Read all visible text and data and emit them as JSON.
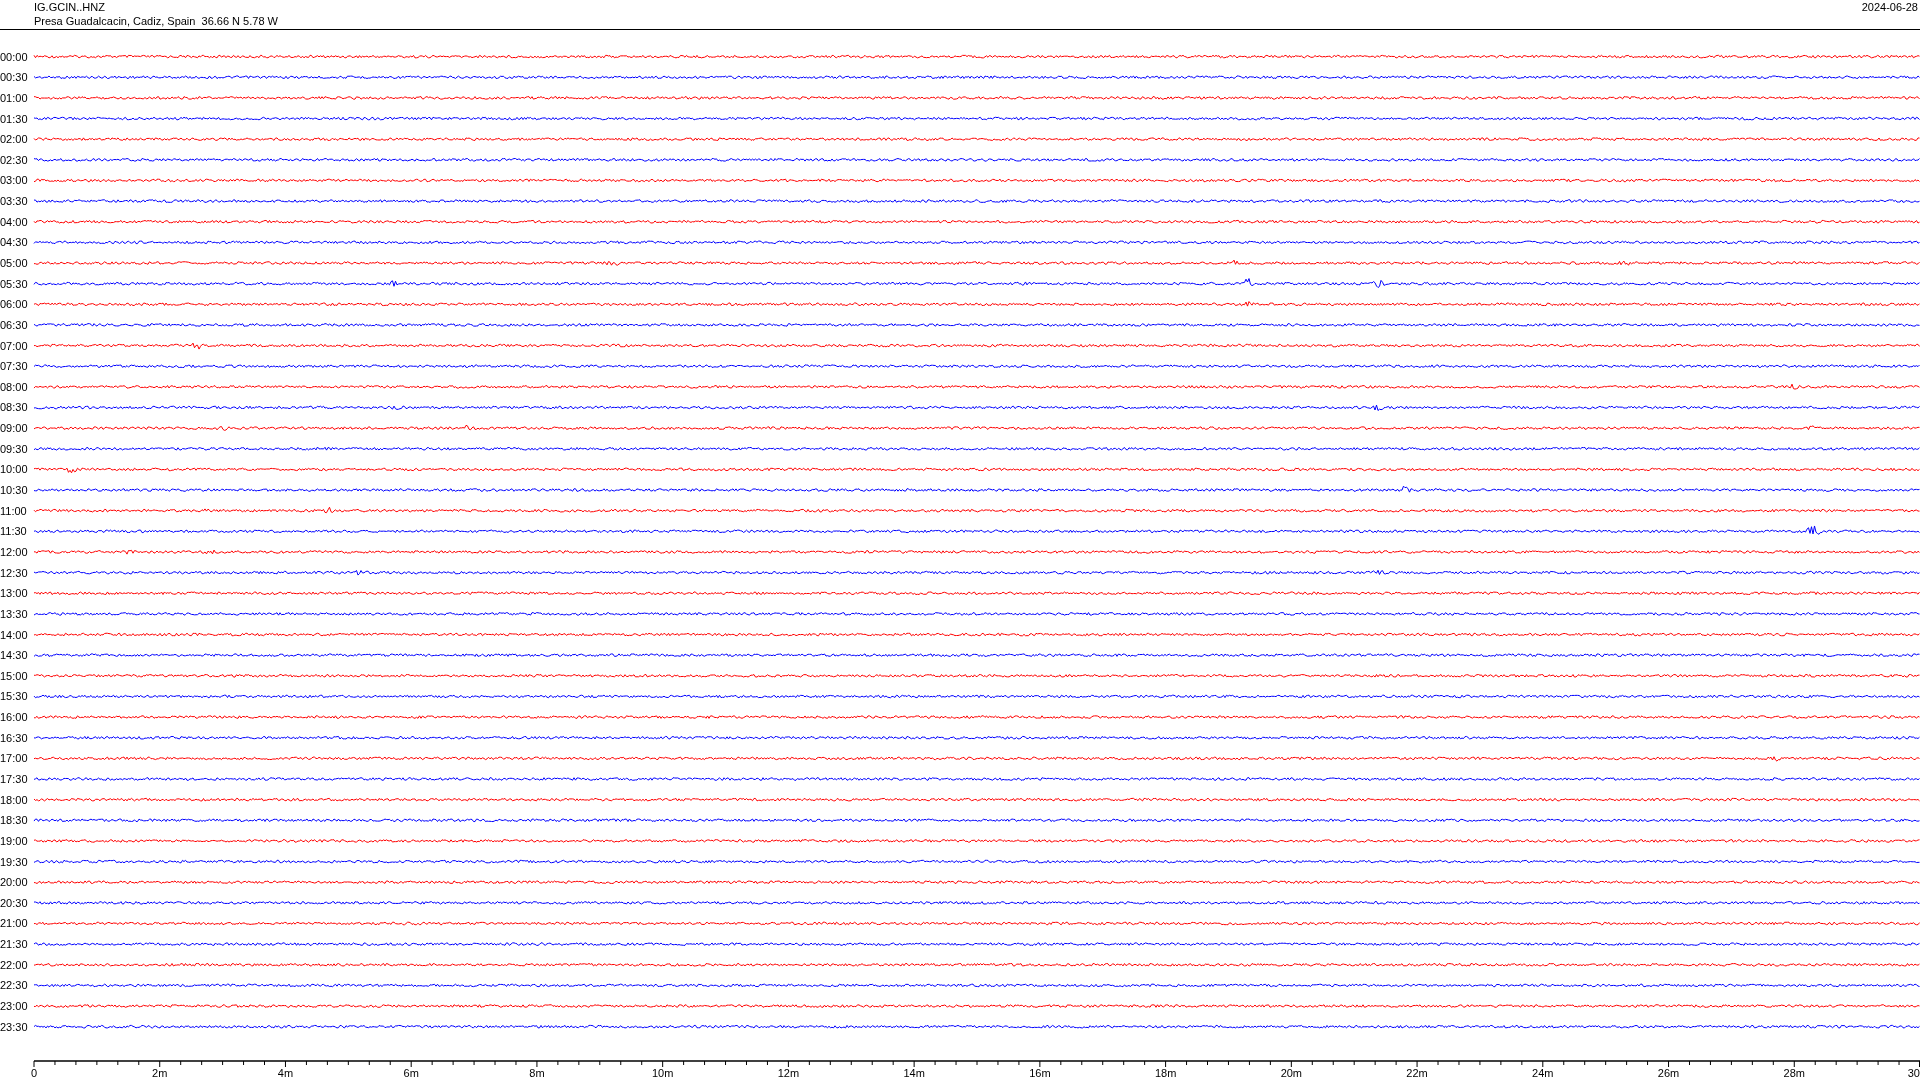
{
  "header": {
    "station": "IG.GCIN..HNZ",
    "location": "Presa Guadalcacin, Cadiz, Spain  36.66 N 5.78 W",
    "date": "2024-06-28"
  },
  "rows": [
    {
      "label": "00:00",
      "color": "#ff0000"
    },
    {
      "label": "00:30",
      "color": "#0000ff"
    },
    {
      "label": "01:00",
      "color": "#ff0000"
    },
    {
      "label": "01:30",
      "color": "#0000ff"
    },
    {
      "label": "02:00",
      "color": "#ff0000"
    },
    {
      "label": "02:30",
      "color": "#0000ff"
    },
    {
      "label": "03:00",
      "color": "#ff0000"
    },
    {
      "label": "03:30",
      "color": "#0000ff"
    },
    {
      "label": "04:00",
      "color": "#ff0000"
    },
    {
      "label": "04:30",
      "color": "#0000ff"
    },
    {
      "label": "05:00",
      "color": "#ff0000"
    },
    {
      "label": "05:30",
      "color": "#0000ff"
    },
    {
      "label": "06:00",
      "color": "#ff0000"
    },
    {
      "label": "06:30",
      "color": "#0000ff"
    },
    {
      "label": "07:00",
      "color": "#ff0000"
    },
    {
      "label": "07:30",
      "color": "#0000ff"
    },
    {
      "label": "08:00",
      "color": "#ff0000"
    },
    {
      "label": "08:30",
      "color": "#0000ff"
    },
    {
      "label": "09:00",
      "color": "#ff0000"
    },
    {
      "label": "09:30",
      "color": "#0000ff"
    },
    {
      "label": "10:00",
      "color": "#ff0000"
    },
    {
      "label": "10:30",
      "color": "#0000ff"
    },
    {
      "label": "11:00",
      "color": "#ff0000"
    },
    {
      "label": "11:30",
      "color": "#0000ff"
    },
    {
      "label": "12:00",
      "color": "#ff0000"
    },
    {
      "label": "12:30",
      "color": "#0000ff"
    },
    {
      "label": "13:00",
      "color": "#ff0000"
    },
    {
      "label": "13:30",
      "color": "#0000ff"
    },
    {
      "label": "14:00",
      "color": "#ff0000"
    },
    {
      "label": "14:30",
      "color": "#0000ff"
    },
    {
      "label": "15:00",
      "color": "#ff0000"
    },
    {
      "label": "15:30",
      "color": "#0000ff"
    },
    {
      "label": "16:00",
      "color": "#ff0000"
    },
    {
      "label": "16:30",
      "color": "#0000ff"
    },
    {
      "label": "17:00",
      "color": "#ff0000"
    },
    {
      "label": "17:30",
      "color": "#0000ff"
    },
    {
      "label": "18:00",
      "color": "#ff0000"
    },
    {
      "label": "18:30",
      "color": "#0000ff"
    },
    {
      "label": "19:00",
      "color": "#ff0000"
    },
    {
      "label": "19:30",
      "color": "#0000ff"
    },
    {
      "label": "20:00",
      "color": "#ff0000"
    },
    {
      "label": "20:30",
      "color": "#0000ff"
    },
    {
      "label": "21:00",
      "color": "#ff0000"
    },
    {
      "label": "21:30",
      "color": "#0000ff"
    },
    {
      "label": "22:00",
      "color": "#ff0000"
    },
    {
      "label": "22:30",
      "color": "#0000ff"
    },
    {
      "label": "23:00",
      "color": "#ff0000"
    },
    {
      "label": "23:30",
      "color": "#0000ff"
    }
  ],
  "x_axis": {
    "ticks": [
      "0",
      "2m",
      "4m",
      "6m",
      "8m",
      "10m",
      "12m",
      "14m",
      "16m",
      "18m",
      "20m",
      "22m",
      "24m",
      "26m",
      "28m",
      "30"
    ]
  }
}
